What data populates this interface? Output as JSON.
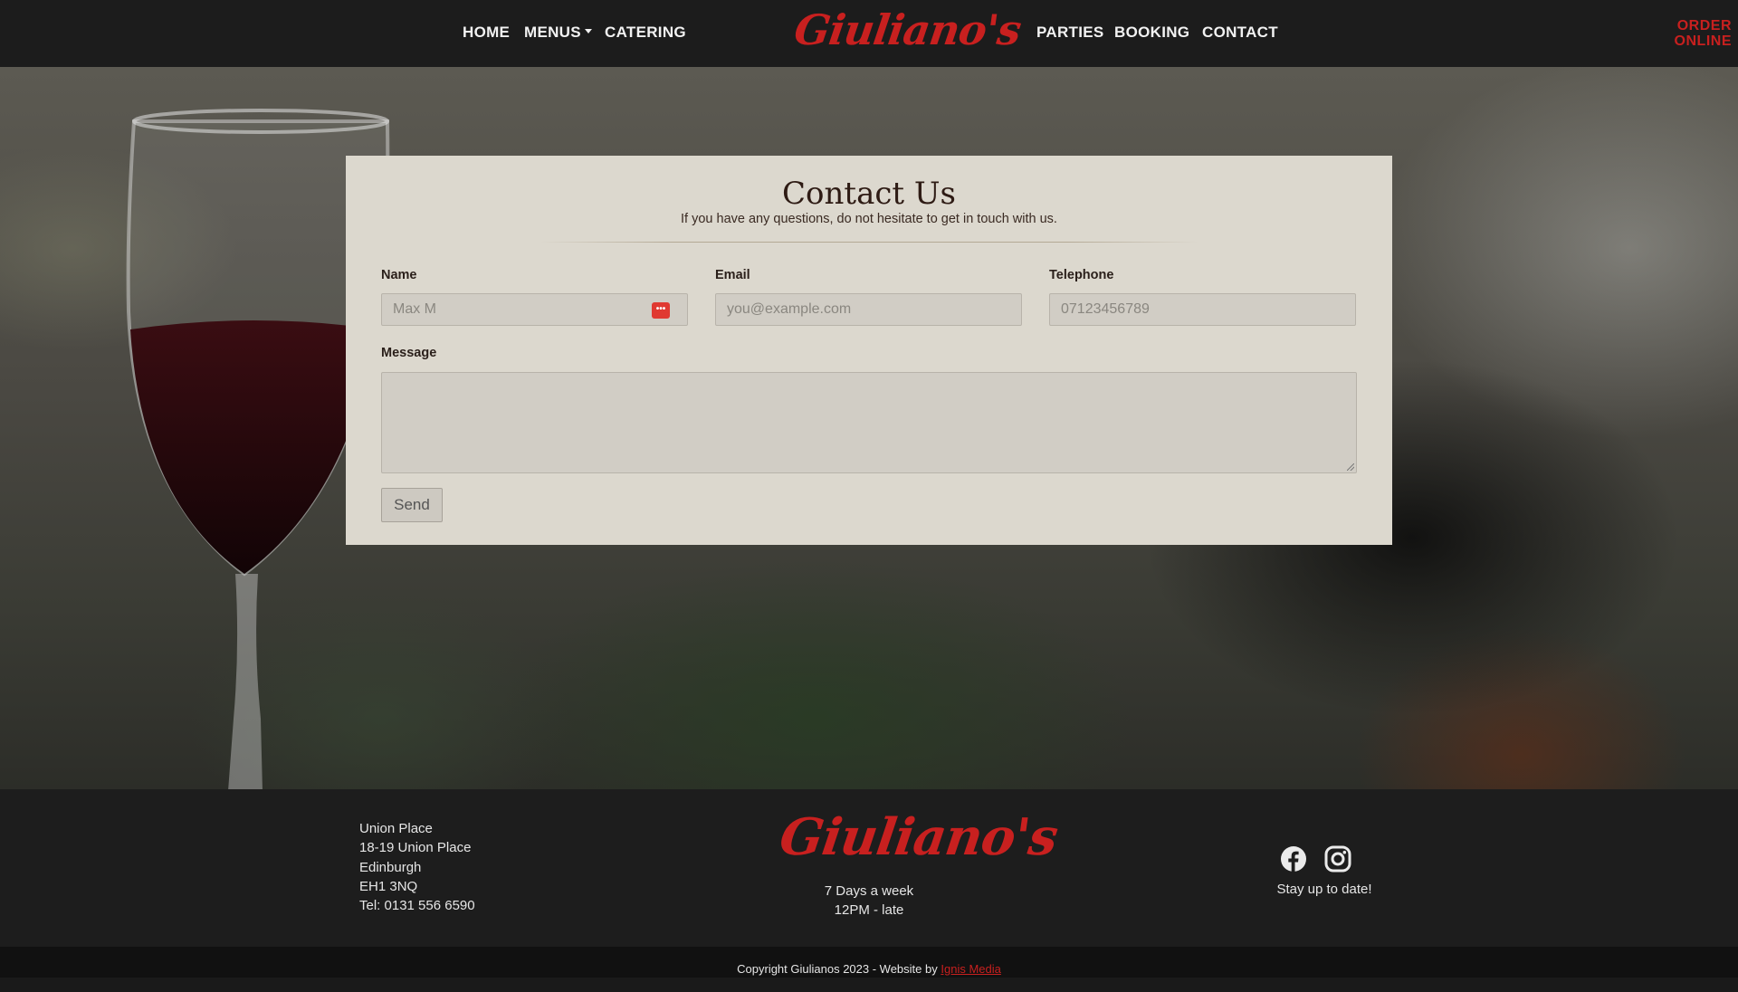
{
  "nav": {
    "left_links": [
      "HOME",
      "MENUS",
      "CATERING"
    ],
    "right_links": [
      "PARTIES",
      "BOOKING",
      "CONTACT"
    ],
    "logo": "Giuliano's",
    "order_online": [
      "ORDER",
      "ONLINE"
    ]
  },
  "contact": {
    "title": "Contact Us",
    "subtitle": "If you have any questions, do not hesitate to get in touch with us.",
    "name_label": "Name",
    "name_placeholder": "Max M",
    "email_label": "Email",
    "email_placeholder": "you@example.com",
    "phone_label": "Telephone",
    "phone_placeholder": "07123456789",
    "message_label": "Message",
    "send_label": "Send"
  },
  "footer": {
    "address": [
      "Union Place",
      "18-19 Union Place",
      "Edinburgh",
      "EH1 3NQ",
      "Tel: 0131 556 6590"
    ],
    "logo": "Giuliano's",
    "hours": [
      "7 Days a week",
      "12PM - late"
    ],
    "stay_up": "Stay up to date!",
    "copyright": "Copyright Giulianos 2023 - Website by",
    "credit_link": "Ignis Media"
  },
  "colors": {
    "brand_red": "#c8201f",
    "nav_bg": "#1c1c1c",
    "card_bg": "#dcd8ce",
    "footer_bg": "#1d1d1d"
  },
  "icons": [
    "password-manager-icon",
    "facebook-icon",
    "instagram-icon"
  ]
}
